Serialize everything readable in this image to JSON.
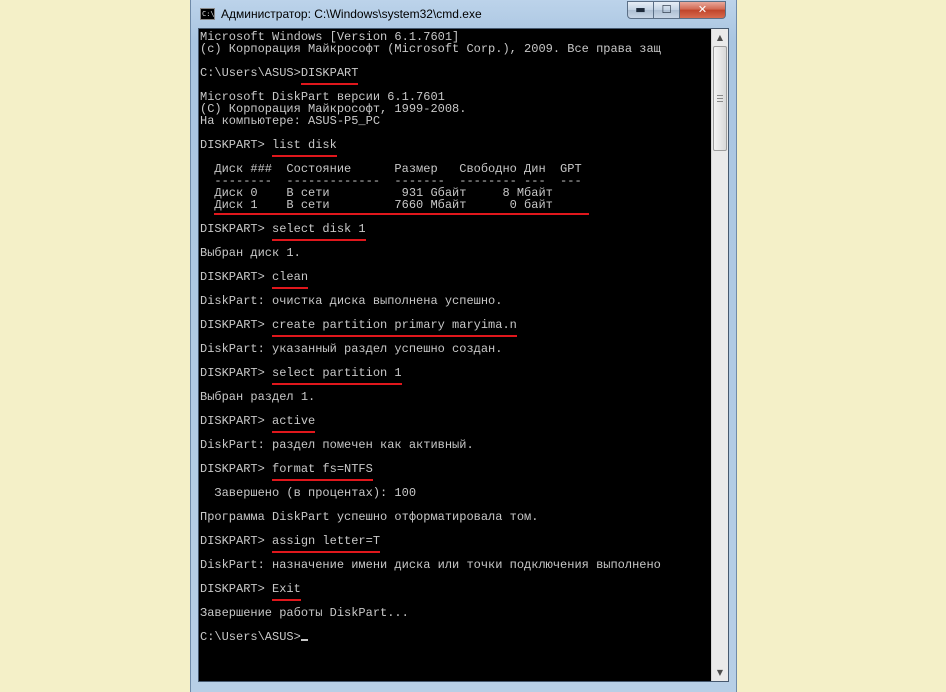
{
  "window": {
    "title": "Администратор: C:\\Windows\\system32\\cmd.exe",
    "icon": "cmd-icon",
    "icon_text": "C:\\",
    "minimize_glyph": "▬",
    "maximize_glyph": "☐",
    "close_glyph": "✕"
  },
  "console": {
    "lines": [
      "Microsoft Windows [Version 6.1.7601]",
      "(c) Корпорация Майкрософт (Microsoft Corp.), 2009. Все права защ",
      "",
      "C:\\Users\\ASUS>DISKPART",
      "",
      "Microsoft DiskPart версии 6.1.7601",
      "(C) Корпорация Майкрософт, 1999-2008.",
      "На компьютере: ASUS-P5_PC",
      "",
      "DISKPART> list disk",
      "",
      "  Диск ###  Состояние      Размер   Свободно Дин  GPT",
      "  --------  -------------  -------  -------- ---  ---",
      "  Диск 0    В сети          931 Gбайт     8 Мбайт",
      "  Диск 1    В сети         7660 Мбайт      0 байт",
      "",
      "DISKPART> select disk 1",
      "",
      "Выбран диск 1.",
      "",
      "DISKPART> clean",
      "",
      "DiskPart: очистка диска выполнена успешно.",
      "",
      "DISKPART> create partition primary maryima.n",
      "",
      "DiskPart: указанный раздел успешно создан.",
      "",
      "DISKPART> select partition 1",
      "",
      "Выбран раздел 1.",
      "",
      "DISKPART> active",
      "",
      "DiskPart: раздел помечен как активный.",
      "",
      "DISKPART> format fs=NTFS",
      "",
      "  Завершено (в процентах): 100",
      "",
      "Программа DiskPart успешно отформатировала том.",
      "",
      "DISKPART> assign letter=T",
      "",
      "DiskPart: назначение имени диска или точки подключения выполнено",
      "",
      "DISKPART> Exit",
      "",
      "Завершение работы DiskPart...",
      "",
      "C:\\Users\\ASUS>"
    ],
    "prompt_prefix": "DISKPART> ",
    "shell_prompt": "C:\\Users\\ASUS>",
    "highlighted_commands": [
      "DISKPART",
      "list disk",
      "select disk 1",
      "clean",
      "create partition primary maryima.n",
      "select partition 1",
      "active",
      "format fs=NTFS",
      "assign letter=T",
      "Exit"
    ],
    "highlight_color": "#e0171c",
    "background_color": "#000000",
    "text_color": "#c8c8c8"
  },
  "scrollbar": {
    "up_glyph": "▲",
    "down_glyph": "▼"
  }
}
